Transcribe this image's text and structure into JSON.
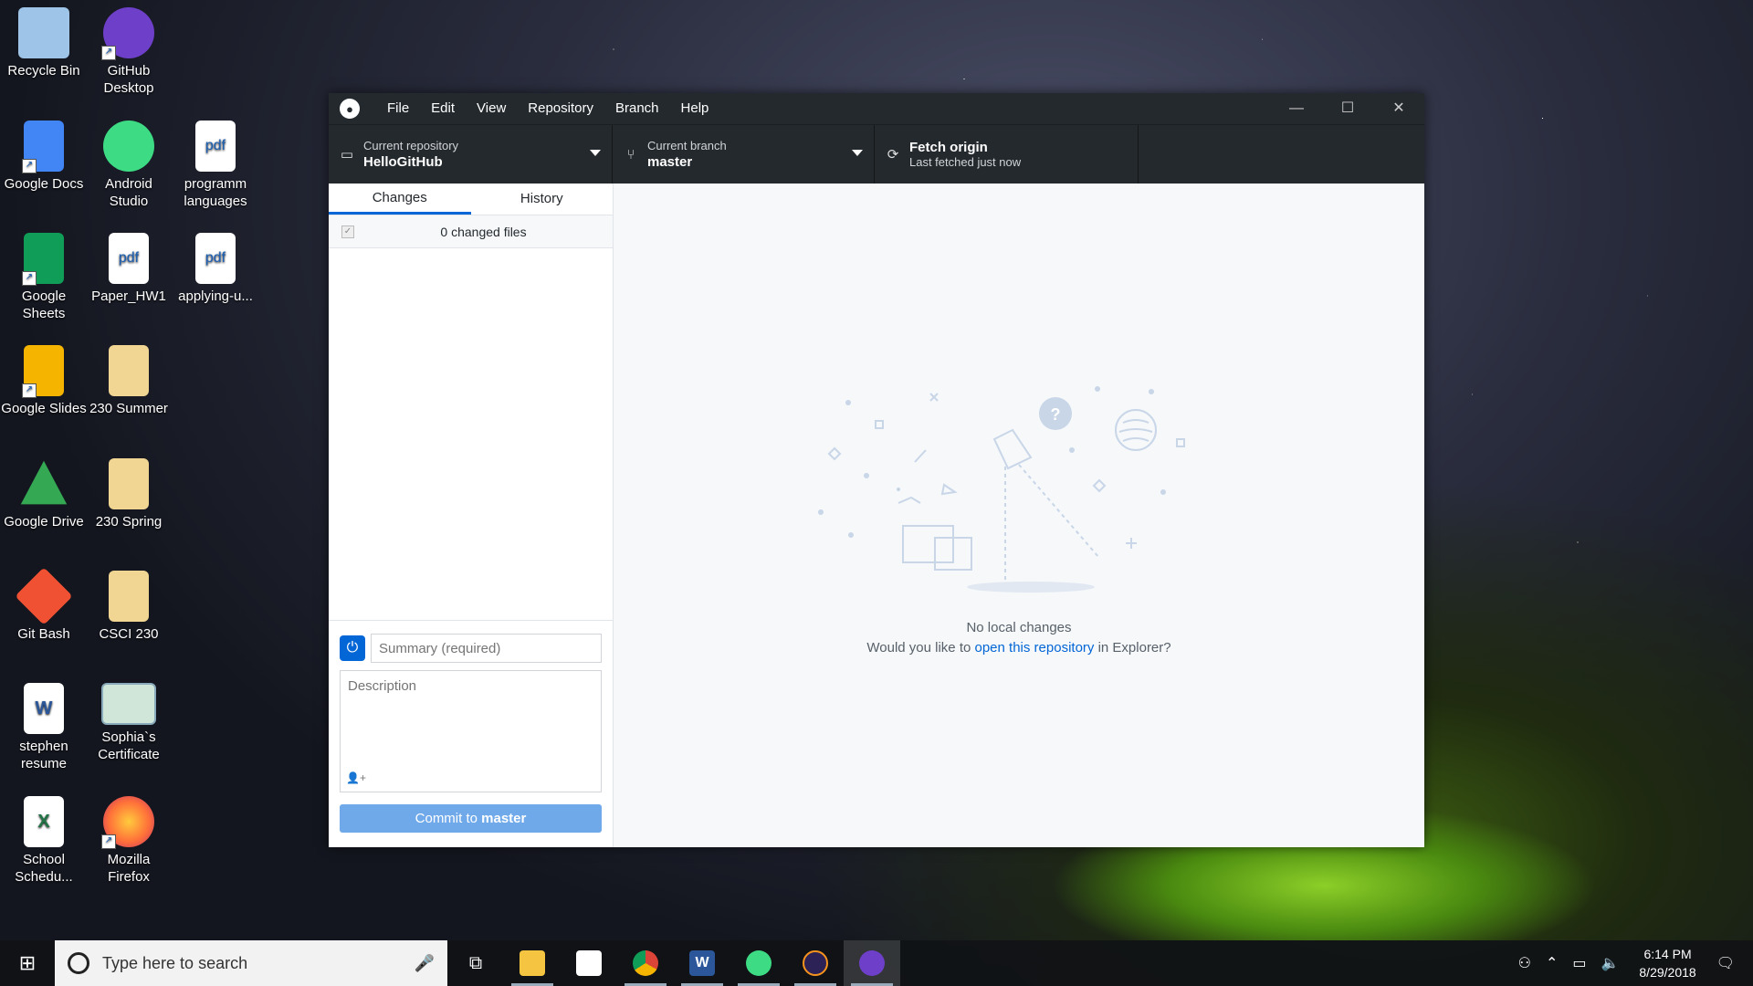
{
  "desktop": {
    "icons": [
      {
        "label": "Recycle Bin",
        "color": "#9ec4e8",
        "icon": "recycle-bin-icon"
      },
      {
        "label": "GitHub Desktop",
        "color": "#6e40c9",
        "icon": "github-desktop-icon"
      },
      {
        "label": "Google Docs",
        "color": "#4285f4",
        "icon": "google-docs-icon"
      },
      {
        "label": "Android Studio",
        "color": "#3ddc84",
        "icon": "android-studio-icon"
      },
      {
        "label": "programm languages",
        "color": "#ffffff",
        "icon": "pdf-file-icon"
      },
      {
        "label": "Google Sheets",
        "color": "#0f9d58",
        "icon": "google-sheets-icon"
      },
      {
        "label": "Paper_HW1",
        "color": "#ffffff",
        "icon": "pdf-file-icon"
      },
      {
        "label": "applying-u...",
        "color": "#ffffff",
        "icon": "pdf-file-icon"
      },
      {
        "label": "Google Slides",
        "color": "#f4b400",
        "icon": "google-slides-icon"
      },
      {
        "label": "230 Summer",
        "color": "#f1d592",
        "icon": "folder-icon"
      },
      {
        "label": "Google Drive",
        "color": "#34a853",
        "icon": "google-drive-icon"
      },
      {
        "label": "230 Spring",
        "color": "#f1d592",
        "icon": "folder-icon"
      },
      {
        "label": "Git Bash",
        "color": "#f05133",
        "icon": "git-bash-icon"
      },
      {
        "label": "CSCI 230",
        "color": "#f1d592",
        "icon": "folder-icon"
      },
      {
        "label": "stephen resume",
        "color": "#2b579a",
        "icon": "word-doc-icon"
      },
      {
        "label": "Sophia`s Certificate",
        "color": "#cfe6d8",
        "icon": "certificate-image-icon"
      },
      {
        "label": "School Schedu...",
        "color": "#217346",
        "icon": "excel-file-icon"
      },
      {
        "label": "Mozilla Firefox",
        "color": "#ff7139",
        "icon": "firefox-icon"
      }
    ]
  },
  "window": {
    "menu": [
      "File",
      "Edit",
      "View",
      "Repository",
      "Branch",
      "Help"
    ],
    "controls": {
      "minimize": "—",
      "maximize": "☐",
      "close": "✕"
    },
    "toolbar": {
      "repo": {
        "label": "Current repository",
        "value": "HelloGitHub"
      },
      "branch": {
        "label": "Current branch",
        "value": "master"
      },
      "fetch": {
        "label": "Fetch origin",
        "sub": "Last fetched just now"
      }
    },
    "tabs": {
      "changes": "Changes",
      "history": "History"
    },
    "changes_header": "0 changed files",
    "commit": {
      "summary_placeholder": "Summary (required)",
      "description_placeholder": "Description",
      "button_prefix": "Commit to ",
      "button_branch": "master"
    },
    "empty_state": {
      "title": "No local changes",
      "line_prefix": "Would you like to ",
      "link": "open this repository",
      "line_suffix": " in Explorer?"
    }
  },
  "taskbar": {
    "search_placeholder": "Type here to search",
    "apps": [
      {
        "name": "task-view",
        "color": "#ffffff",
        "open": false
      },
      {
        "name": "file-explorer",
        "color": "#f5c542",
        "open": true
      },
      {
        "name": "microsoft-store",
        "color": "#ffffff",
        "open": false
      },
      {
        "name": "chrome",
        "color": "#db4437",
        "open": true
      },
      {
        "name": "word",
        "color": "#2b579a",
        "open": true
      },
      {
        "name": "android-studio",
        "color": "#3ddc84",
        "open": true
      },
      {
        "name": "eclipse",
        "color": "#2c2255",
        "open": true
      },
      {
        "name": "github-desktop",
        "color": "#6e40c9",
        "open": true,
        "active": true
      }
    ],
    "time": "6:14 PM",
    "date": "8/29/2018"
  }
}
